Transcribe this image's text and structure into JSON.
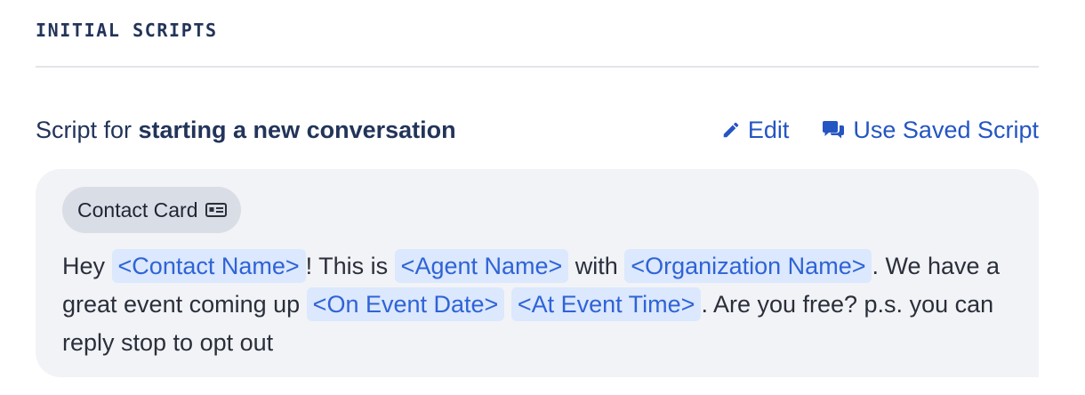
{
  "section": {
    "title": "INITIAL SCRIPTS"
  },
  "script": {
    "heading_prefix": "Script for ",
    "heading_strong": "starting a new conversation",
    "edit_label": "Edit",
    "use_saved_label": "Use Saved Script"
  },
  "card": {
    "chip_label": "Contact Card",
    "message": {
      "t1": "Hey ",
      "tok1": "<Contact Name>",
      "t2": "! This is ",
      "tok2": "<Agent Name>",
      "t3": " with ",
      "tok3": "<Organization Name>",
      "t4": ". We have a great event coming up ",
      "tok4": "<On Event Date>",
      "t5": " ",
      "tok5": "<At Event Time>",
      "t6": ". Are you free? p.s. you can reply stop to opt out"
    }
  },
  "icons": {
    "edit": "pencil-icon",
    "use_saved": "chat-bubbles-icon",
    "chip": "id-card-icon"
  },
  "colors": {
    "title": "#23345a",
    "link": "#2455c3",
    "card_bg": "#f2f3f7",
    "chip_bg": "#d9dde6",
    "token_bg": "#dbe8fd",
    "token_text": "#2f63d6"
  }
}
